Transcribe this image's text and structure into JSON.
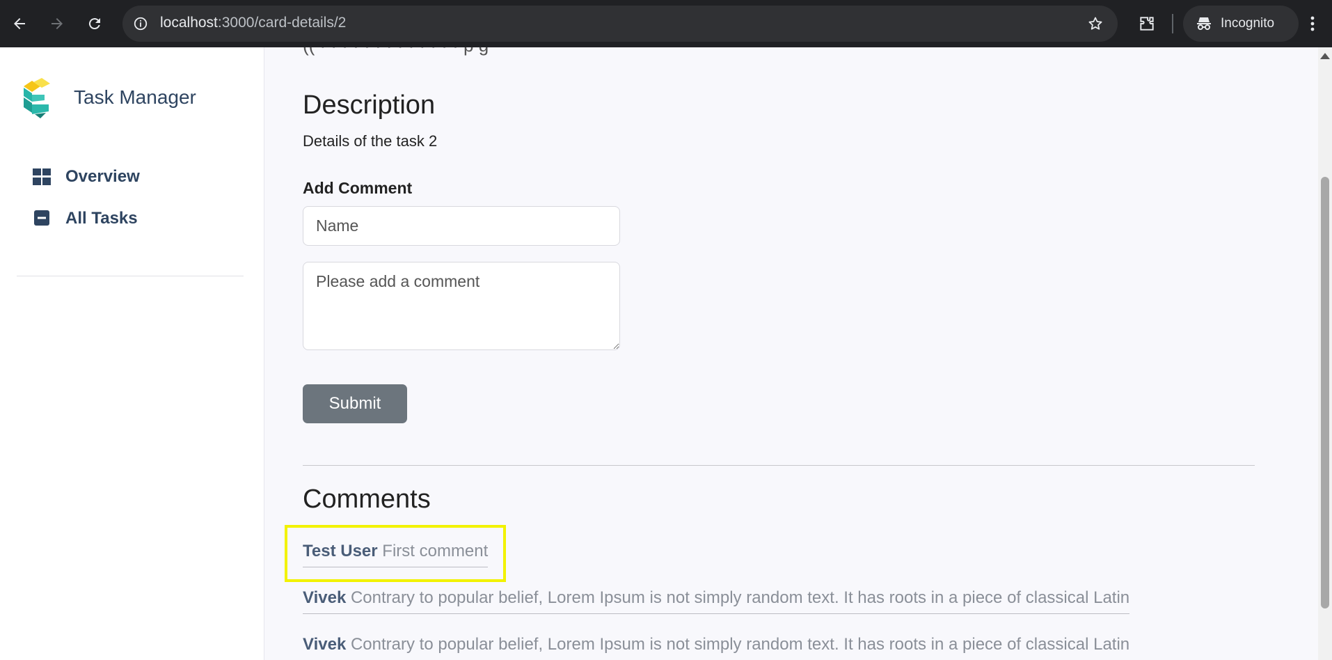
{
  "browser": {
    "url_host": "localhost",
    "url_path": ":3000/card-details/2",
    "incognito_label": "Incognito"
  },
  "sidebar": {
    "brand_title": "Task Manager",
    "items": [
      {
        "label": "Overview",
        "icon": "grid-icon"
      },
      {
        "label": "All Tasks",
        "icon": "minus-square-icon"
      }
    ]
  },
  "main": {
    "top_cut_text": "((  ·  ·  ·  ·  ·  ·  ·  ·  ·  ·  ·  ·  ·  p  g",
    "description_heading": "Description",
    "description_text": "Details of the task 2",
    "add_comment_label": "Add Comment",
    "name_placeholder": "Name",
    "comment_placeholder": "Please add a comment",
    "submit_label": "Submit",
    "comments_heading": "Comments",
    "comments": [
      {
        "author": "Test User",
        "text": "First comment"
      },
      {
        "author": "Vivek",
        "text": "Contrary to popular belief, Lorem Ipsum is not simply random text. It has roots in a piece of classical Latin"
      },
      {
        "author": "Vivek",
        "text": "Contrary to popular belief, Lorem Ipsum is not simply random text. It has roots in a piece of classical Latin"
      }
    ]
  },
  "colors": {
    "sidebar_text": "#2e4460",
    "submit_bg": "#6c757d",
    "highlight": "#f2f200"
  }
}
